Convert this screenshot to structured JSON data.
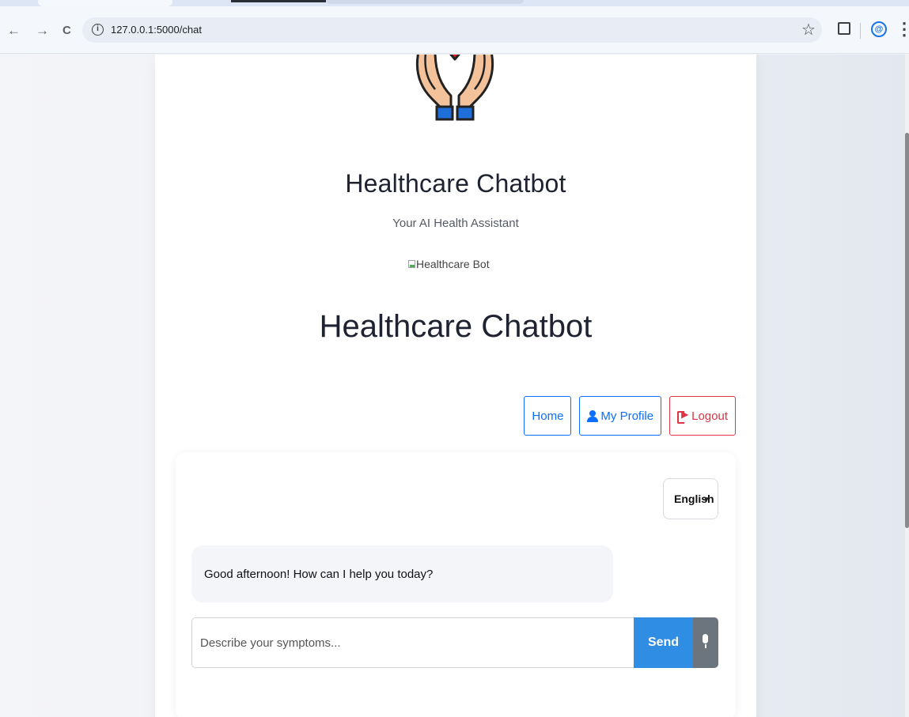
{
  "browser": {
    "url": "127.0.0.1:5000/chat",
    "back_glyph": "←",
    "forward_glyph": "→",
    "reload_glyph": "C",
    "info_glyph": "i",
    "star_glyph": "☆",
    "menu_glyph": "⋮",
    "profile_glyph": "@"
  },
  "header": {
    "brand_title": "Healthcare Chatbot",
    "brand_subtitle": "Your AI Health Assistant",
    "bot_image_alt": "Healthcare Bot",
    "main_heading": "Healthcare Chatbot"
  },
  "nav": {
    "home_label": "Home",
    "profile_label": "My Profile",
    "logout_label": "Logout"
  },
  "chat": {
    "language": "English",
    "language_caret": "▼",
    "bot_message": "Good afternoon! How can I help you today?",
    "input_placeholder": "Describe your symptoms...",
    "input_value": "",
    "send_label": "Send"
  },
  "colors": {
    "primary": "#0d6efd",
    "danger": "#dc3545",
    "send": "#2f8de4",
    "mic": "#6c757d"
  }
}
